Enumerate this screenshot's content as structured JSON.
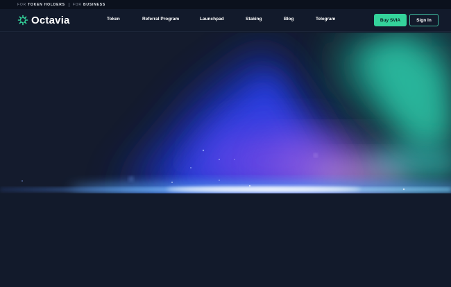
{
  "topbar": {
    "for_label_1": "FOR",
    "token_holders": "TOKEN HOLDERS",
    "for_label_2": "FOR",
    "business": "BUSINESS"
  },
  "brand": {
    "name": "Octavia",
    "accent_color": "#34d39b"
  },
  "nav": {
    "items": [
      "Token",
      "Referral Program",
      "Launchpad",
      "Staking",
      "Blog",
      "Telegram"
    ]
  },
  "actions": {
    "buy_label": "Buy SVIA",
    "signin_label": "Sign In"
  },
  "icons": {
    "logo": "octavia-logo-icon"
  }
}
